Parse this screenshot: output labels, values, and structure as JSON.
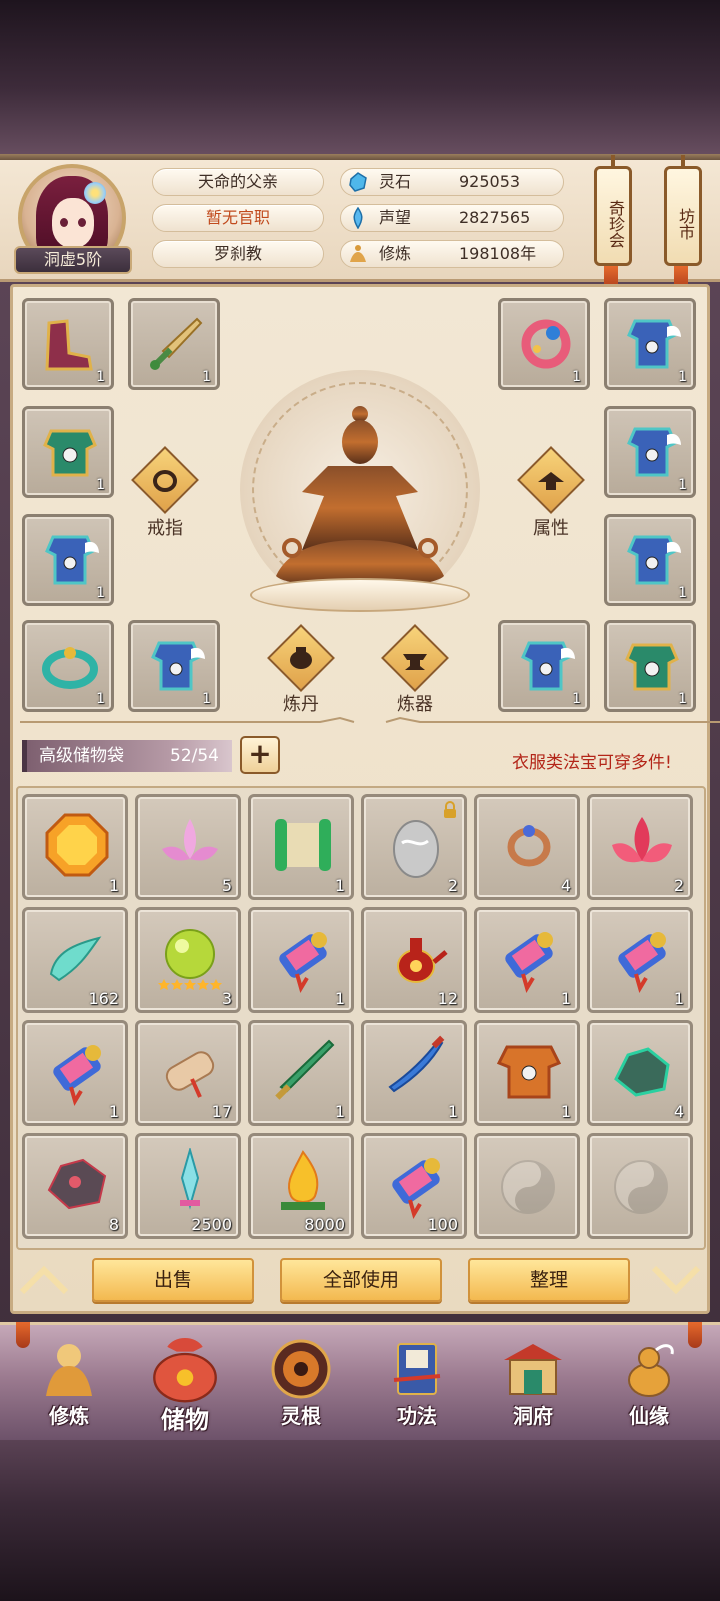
{
  "player": {
    "name": "天命的父亲",
    "official_title": "暂无官职",
    "sect": "罗刹教",
    "rank": "洞虚5阶"
  },
  "resources": [
    {
      "label": "灵石",
      "value": "925053",
      "icon": "spirit-stone-icon"
    },
    {
      "label": "声望",
      "value": "2827565",
      "icon": "prestige-icon"
    },
    {
      "label": "修炼",
      "value": "198108年",
      "icon": "meditation-icon"
    }
  ],
  "side_buttons": {
    "treasure_fair": "奇珍会",
    "market": "坊市"
  },
  "equipment": {
    "left_slots": [
      "1",
      "1",
      "1",
      "1",
      "1"
    ],
    "right_slots": [
      "1",
      "1",
      "1",
      "1",
      "1"
    ],
    "actions": {
      "ring": "戒指",
      "attributes": "属性",
      "alchemy": "炼丹",
      "forging": "炼器"
    }
  },
  "storage": {
    "bag_name": "高级储物袋",
    "capacity": "52/54",
    "add_label": "+",
    "tip": "衣服类法宝可穿多件!",
    "items": [
      {
        "icon": "orange-gem-icon",
        "count": "1"
      },
      {
        "icon": "pink-lotus-icon",
        "count": "5"
      },
      {
        "icon": "jade-scroll-icon",
        "count": "1"
      },
      {
        "icon": "silver-egg-icon",
        "count": "2",
        "locked": true
      },
      {
        "icon": "copper-ring-icon",
        "count": "4"
      },
      {
        "icon": "red-lotus-icon",
        "count": "2"
      },
      {
        "icon": "cloud-feather-icon",
        "count": "162"
      },
      {
        "icon": "green-orb-icon",
        "count": "3",
        "stars": 5
      },
      {
        "icon": "scroll-icon",
        "count": "1"
      },
      {
        "icon": "red-teapot-icon",
        "count": "12"
      },
      {
        "icon": "scroll-icon",
        "count": "1"
      },
      {
        "icon": "scroll-icon",
        "count": "1"
      },
      {
        "icon": "scroll-icon",
        "count": "1"
      },
      {
        "icon": "paper-scroll-icon",
        "count": "17"
      },
      {
        "icon": "green-sword-icon",
        "count": "1"
      },
      {
        "icon": "blue-sabre-icon",
        "count": "1"
      },
      {
        "icon": "gold-armor-icon",
        "count": "1"
      },
      {
        "icon": "jade-ore-icon",
        "count": "4"
      },
      {
        "icon": "dark-ore-icon",
        "count": "8"
      },
      {
        "icon": "crystal-blade-icon",
        "count": "2500"
      },
      {
        "icon": "golden-flame-icon",
        "count": "8000"
      },
      {
        "icon": "scroll-icon",
        "count": "100"
      },
      {
        "icon": "empty-slot-icon",
        "count": ""
      },
      {
        "icon": "empty-slot-icon",
        "count": ""
      }
    ]
  },
  "actions": {
    "sell": "出售",
    "use_all": "全部使用",
    "organize": "整理"
  },
  "nav": [
    {
      "label": "修炼",
      "icon": "cultivate-icon"
    },
    {
      "label": "储物",
      "icon": "storage-bag-icon",
      "active": true
    },
    {
      "label": "灵根",
      "icon": "spirit-root-icon"
    },
    {
      "label": "功法",
      "icon": "technique-book-icon"
    },
    {
      "label": "洞府",
      "icon": "cave-mansion-icon"
    },
    {
      "label": "仙缘",
      "icon": "immortal-fate-icon"
    }
  ],
  "colors": {
    "accent_gold": "#f3b950",
    "tip_red": "#b32518",
    "frame_purple": "#6d526a"
  }
}
